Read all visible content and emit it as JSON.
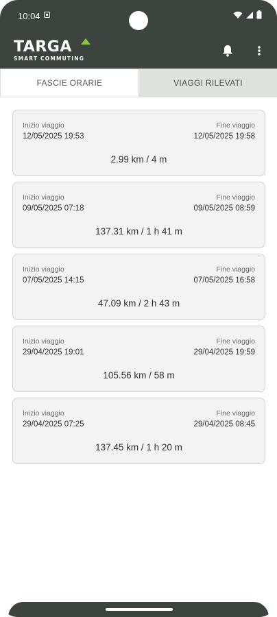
{
  "status": {
    "time": "10:04"
  },
  "brand": {
    "name": "TARGA",
    "tagline": "SMART COMMUTING"
  },
  "tabs": [
    {
      "label": "FASCIE ORARIE",
      "active": true
    },
    {
      "label": "VIAGGI RILEVATI",
      "active": false
    }
  ],
  "trips": [
    {
      "start_label": "Inizio viaggio",
      "start": "12/05/2025 19:53",
      "end_label": "Fine viaggio",
      "end": "12/05/2025 19:58",
      "summary": "2.99 km / 4 m"
    },
    {
      "start_label": "Inizio viaggio",
      "start": "09/05/2025 07:18",
      "end_label": "Fine viaggio",
      "end": "09/05/2025 08:59",
      "summary": "137.31 km / 1 h 41 m"
    },
    {
      "start_label": "Inizio viaggio",
      "start": "07/05/2025 14:15",
      "end_label": "Fine viaggio",
      "end": "07/05/2025 16:58",
      "summary": "47.09 km / 2 h 43 m"
    },
    {
      "start_label": "Inizio viaggio",
      "start": "29/04/2025 19:01",
      "end_label": "Fine viaggio",
      "end": "29/04/2025 19:59",
      "summary": "105.56 km / 58 m"
    },
    {
      "start_label": "Inizio viaggio",
      "start": "29/04/2025 07:25",
      "end_label": "Fine viaggio",
      "end": "29/04/2025 08:45",
      "summary": "137.45 km / 1 h 20 m"
    }
  ],
  "colors": {
    "header": "#3d433f",
    "accent": "#8dc63f",
    "card": "#f3f3f3"
  },
  "icons": {
    "notifications": "bell-icon",
    "overflow": "more-vert-icon"
  }
}
